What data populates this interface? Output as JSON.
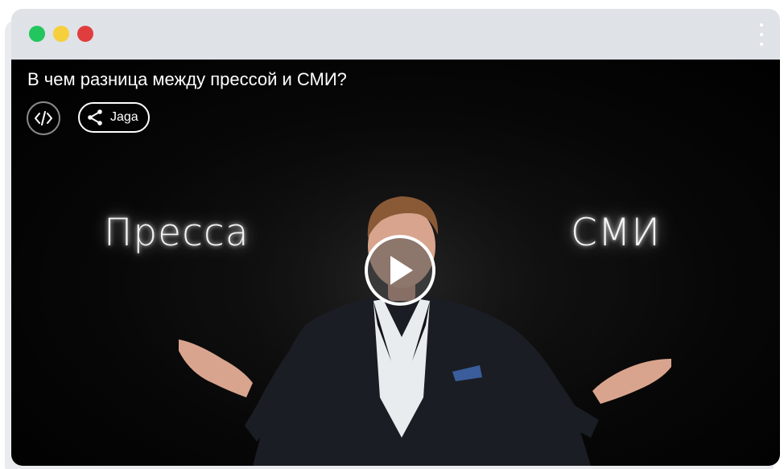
{
  "window": {
    "controls": [
      "green-dot",
      "yellow-dot",
      "red-dot"
    ],
    "menu_icon": "kebab-menu-icon"
  },
  "video": {
    "title": "В чем разница между прессой и СМИ?",
    "embed_icon": "code-embed-icon",
    "share_label": "Jaga",
    "share_icon": "share-icon",
    "left_caption": "Пресса",
    "right_caption": "СМИ",
    "play_icon": "play-icon"
  },
  "colors": {
    "window_bg": "#dfe2e7",
    "dot_green": "#23c55e",
    "dot_yellow": "#f6cf3d",
    "dot_red": "#e03e3e",
    "video_bg": "#000000",
    "text": "#ffffff"
  }
}
